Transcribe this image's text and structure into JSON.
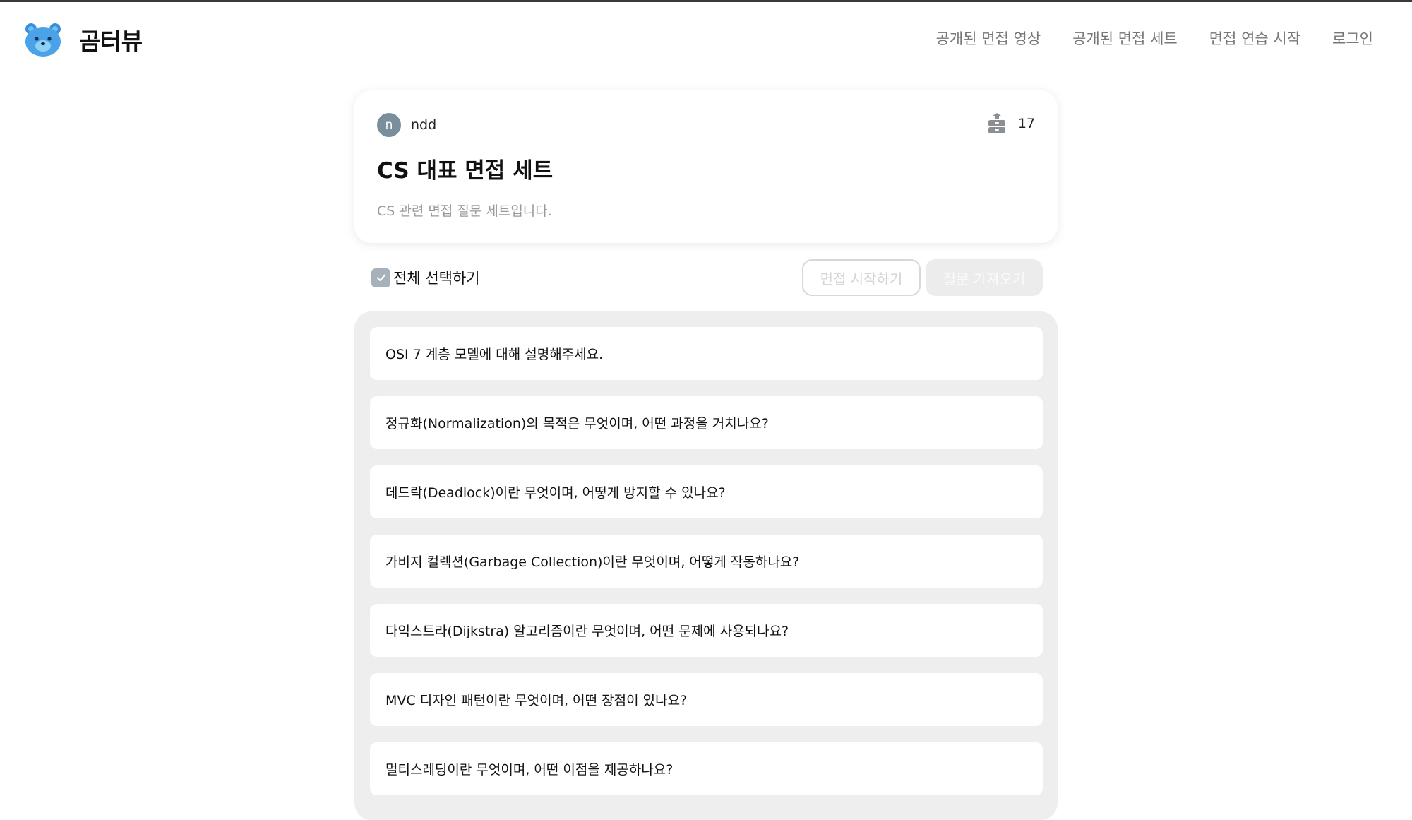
{
  "header": {
    "logo_text": "곰터뷰",
    "nav": [
      "공개된 면접 영상",
      "공개된 면접 세트",
      "면접 연습 시작",
      "로그인"
    ]
  },
  "set": {
    "author_initial": "n",
    "author_name": "ndd",
    "save_count": "17",
    "title": "CS 대표 면접 세트",
    "description": "CS 관련 면접 질문 세트입니다."
  },
  "controls": {
    "select_all_label": "전체 선택하기",
    "select_all_checked": true,
    "start_button": "면접 시작하기",
    "import_button": "질문 가져오기"
  },
  "questions": [
    "OSI 7 계층 모델에 대해 설명해주세요.",
    "정규화(Normalization)의 목적은 무엇이며, 어떤 과정을 거치나요?",
    "데드락(Deadlock)이란 무엇이며, 어떻게 방지할 수 있나요?",
    "가비지 컬렉션(Garbage Collection)이란 무엇이며, 어떻게 작동하나요?",
    "다익스트라(Dijkstra) 알고리즘이란 무엇이며, 어떤 문제에 사용되나요?",
    "MVC 디자인 패턴이란 무엇이며, 어떤 장점이 있나요?",
    "멀티스레딩이란 무엇이며, 어떤 이점을 제공하나요?"
  ],
  "colors": {
    "brand_blue": "#4aa3e8",
    "avatar_bg": "#7a8f9c",
    "list_bg": "#eeeeee",
    "checkbox_bg": "#a7b1bb"
  }
}
